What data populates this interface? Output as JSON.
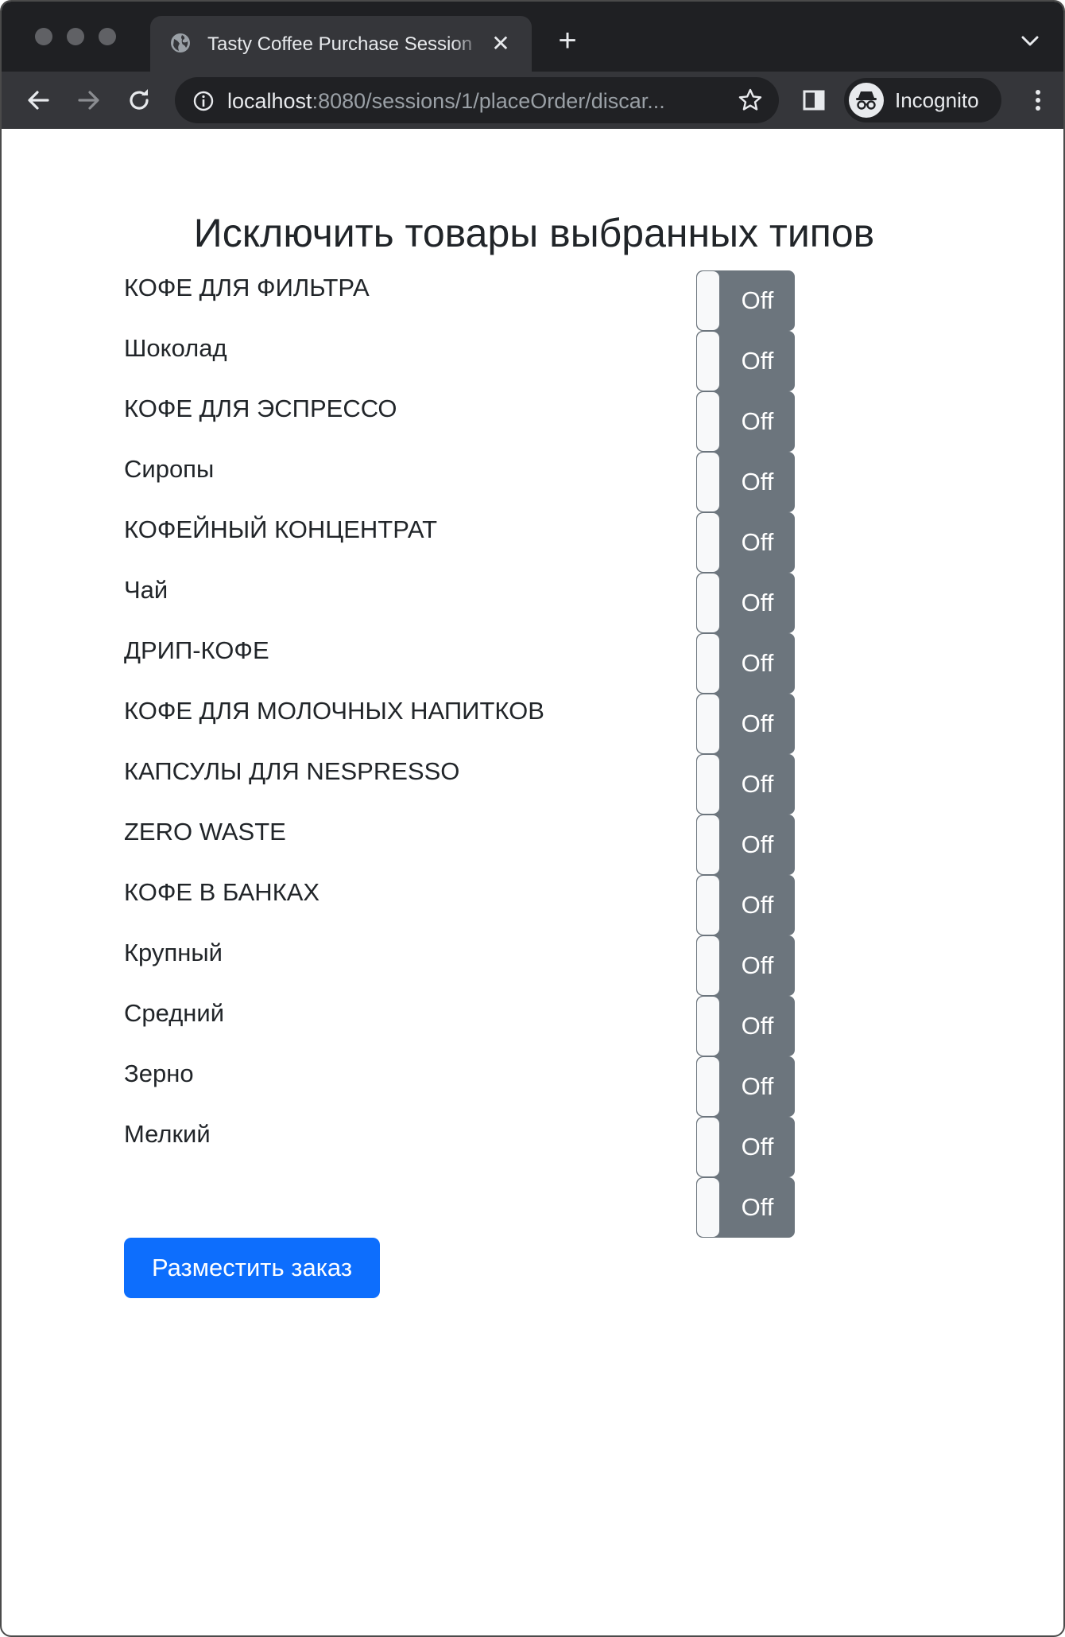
{
  "browser": {
    "tab_title": "Tasty Coffee Purchase Session",
    "tab_close_glyph": "✕",
    "new_tab_glyph": "+",
    "url_host": "localhost",
    "url_rest": ":8080/sessions/1/placeOrder/discar...",
    "incognito_label": "Incognito",
    "colors": {
      "frame": "#1f2023",
      "toolbar": "#35363a",
      "omnibox": "#202124"
    }
  },
  "page": {
    "heading": "Исключить товары выбранных типов",
    "toggle_off_label": "Off",
    "items": [
      {
        "label": "КОФЕ ДЛЯ ФИЛЬТРА",
        "state": "Off"
      },
      {
        "label": "Шоколад",
        "state": "Off"
      },
      {
        "label": "КОФЕ ДЛЯ ЭСПРЕССО",
        "state": "Off"
      },
      {
        "label": "Сиропы",
        "state": "Off"
      },
      {
        "label": "КОФЕЙНЫЙ КОНЦЕНТРАТ",
        "state": "Off"
      },
      {
        "label": "Чай",
        "state": "Off"
      },
      {
        "label": "ДРИП-КОФЕ",
        "state": "Off"
      },
      {
        "label": "КОФЕ ДЛЯ МОЛОЧНЫХ НАПИТКОВ",
        "state": "Off"
      },
      {
        "label": "КАПСУЛЫ ДЛЯ NESPRESSO",
        "state": "Off"
      },
      {
        "label": "ZERO WASTE",
        "state": "Off"
      },
      {
        "label": "КОФЕ В БАНКАХ",
        "state": "Off"
      },
      {
        "label": "Крупный",
        "state": "Off"
      },
      {
        "label": "Средний",
        "state": "Off"
      },
      {
        "label": "Зерно",
        "state": "Off"
      },
      {
        "label": "Мелкий",
        "state": "Off"
      },
      {
        "label": "",
        "state": "Off"
      }
    ],
    "submit_label": "Разместить заказ",
    "colors": {
      "toggle_off": "#6c757d",
      "primary": "#0d6efd",
      "text": "#212529"
    }
  }
}
